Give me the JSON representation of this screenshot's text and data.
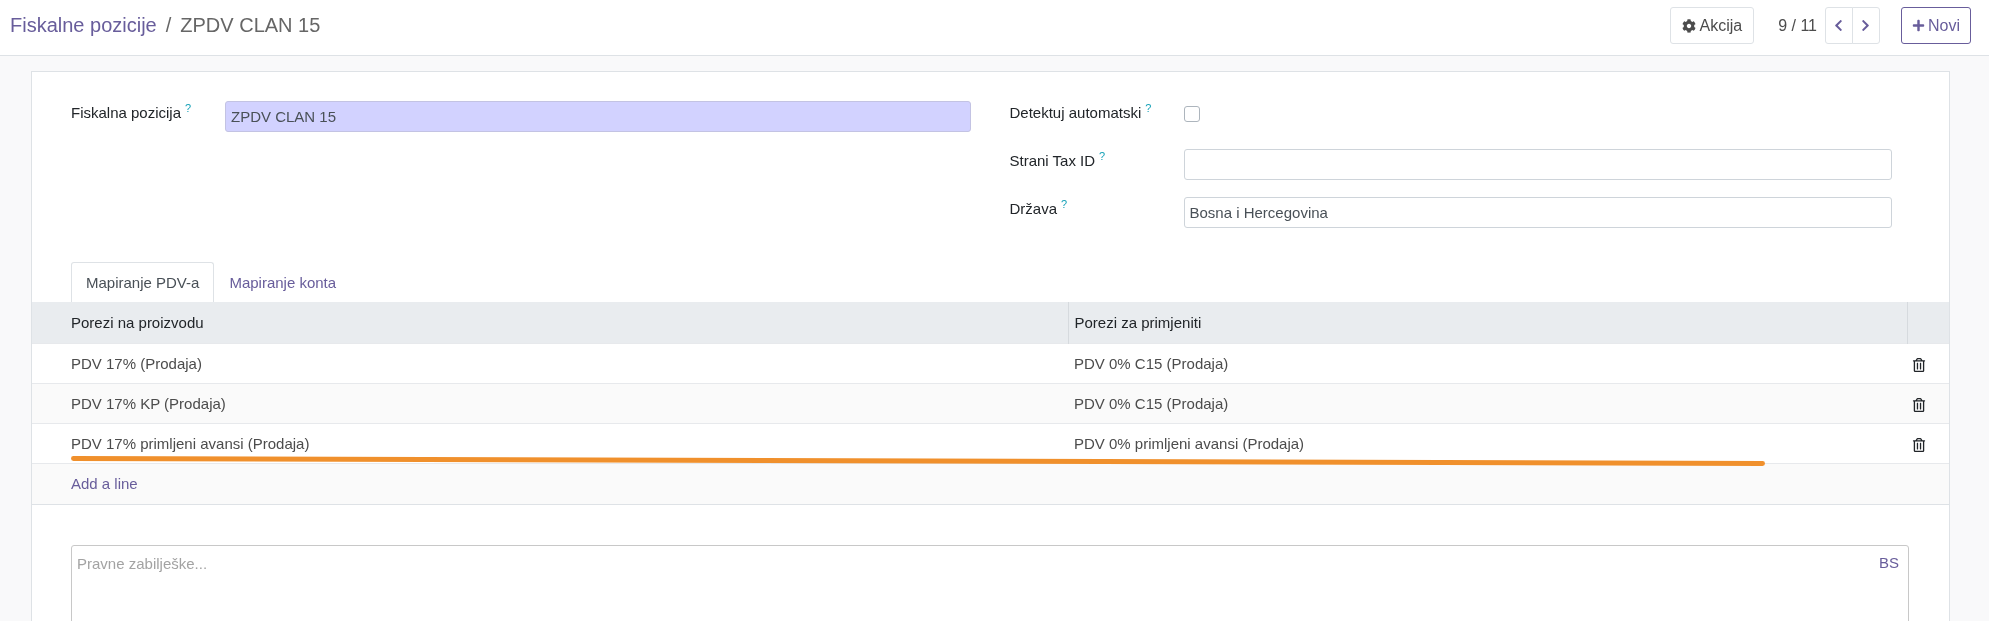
{
  "breadcrumb": {
    "parent": "Fiskalne pozicije",
    "separator": "/",
    "current": "ZPDV CLAN 15"
  },
  "control_panel": {
    "action_button": "Akcija",
    "pager": "9 / 11",
    "new_button": "Novi"
  },
  "form": {
    "left_fields": [
      {
        "kind": "text",
        "label": "Fiskalna pozicija",
        "help": "?",
        "value": "ZPDV CLAN 15",
        "required": true
      }
    ],
    "right_fields": [
      {
        "kind": "checkbox",
        "label": "Detektuj automatski",
        "help": "?",
        "checked": false
      },
      {
        "kind": "text",
        "label": "Strani Tax ID",
        "help": "?",
        "required": false
      },
      {
        "kind": "text",
        "label": "Država",
        "help": "?",
        "value": "Bosna i Hercegovina",
        "required": false
      }
    ]
  },
  "tabs": [
    {
      "label": "Mapiranje PDV-a",
      "selected": true
    },
    {
      "label": "Mapiranje konta",
      "selected": false
    }
  ],
  "table": {
    "columns": [
      "Porezi na proizvodu",
      "Porezi za primjeniti"
    ],
    "rows": [
      {
        "cells": [
          "PDV 17% (Prodaja)",
          "PDV 0% C15 (Prodaja)"
        ],
        "underlined": false
      },
      {
        "cells": [
          "PDV 17% KP (Prodaja)",
          "PDV 0% C15 (Prodaja)"
        ],
        "underlined": false
      },
      {
        "cells": [
          "PDV 17% primljeni avansi (Prodaja)",
          "PDV 0% primljeni avansi (Prodaja)"
        ],
        "underlined": true
      }
    ],
    "add_line": "Add a line"
  },
  "notes": {
    "placeholder": "Pravne zabilješke...",
    "language": "BS"
  }
}
